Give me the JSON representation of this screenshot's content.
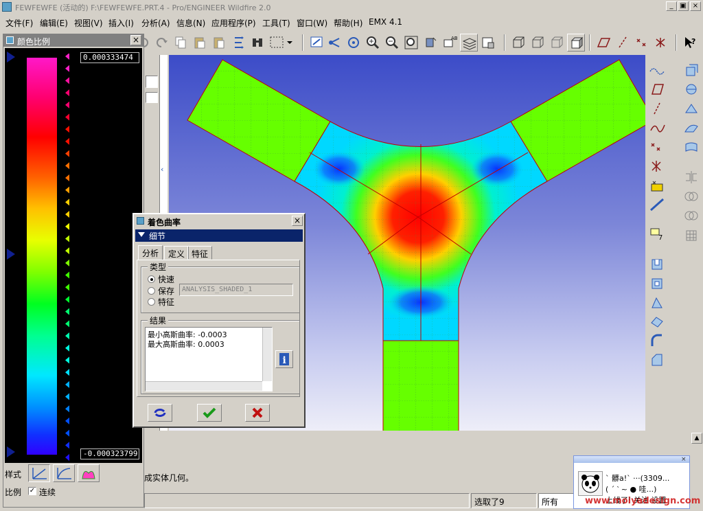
{
  "window": {
    "title": "FEWFEWFE (活动的) F:\\FEWFEWFE.PRT.4 - Pro/ENGINEER Wildfire 2.0",
    "min_label": "_",
    "max_label": "▣",
    "close_label": "×"
  },
  "menu": [
    "文件(F)",
    "编辑(E)",
    "视图(V)",
    "插入(I)",
    "分析(A)",
    "信息(N)",
    "应用程序(P)",
    "工具(T)",
    "窗口(W)",
    "帮助(H)",
    "EMX 4.1"
  ],
  "scale_panel": {
    "title": "颜色比例",
    "max_value": "0.000333474",
    "min_value": "-0.000323799",
    "style_label": "样式",
    "scale_label": "比例",
    "continuous_label": "连续",
    "continuous_checked": true
  },
  "dialog": {
    "title": "着色曲率",
    "section": "细节",
    "tabs": [
      "分析",
      "定义",
      "特征"
    ],
    "type_group": "类型",
    "type_options": [
      {
        "label": "快速",
        "selected": true
      },
      {
        "label": "保存",
        "selected": false
      },
      {
        "label": "特征",
        "selected": false
      }
    ],
    "name_field": "ANALYSIS_SHADED_1",
    "result_group": "结果",
    "results": [
      "最小高斯曲率: -0.0003",
      "最大高斯曲率: 0.0003"
    ]
  },
  "message_area": {
    "text": "成实体几何。"
  },
  "status": {
    "selected": "选取了9",
    "filter": "所有"
  },
  "popup": {
    "line1": "`   髒a!`  ···(3309...",
    "line2": "( ´ ‵ ~ ● 哇...)",
    "line3": "上线了! 关注  设置"
  },
  "watermark": "www.moiyadesign.com",
  "colors": {
    "accent": "#0a246a",
    "model_green": "#66ff00",
    "model_red": "#ff0000",
    "model_blue": "#0a3cff",
    "background_top": "#3c4cc8",
    "background_bottom": "#eeeef8"
  }
}
